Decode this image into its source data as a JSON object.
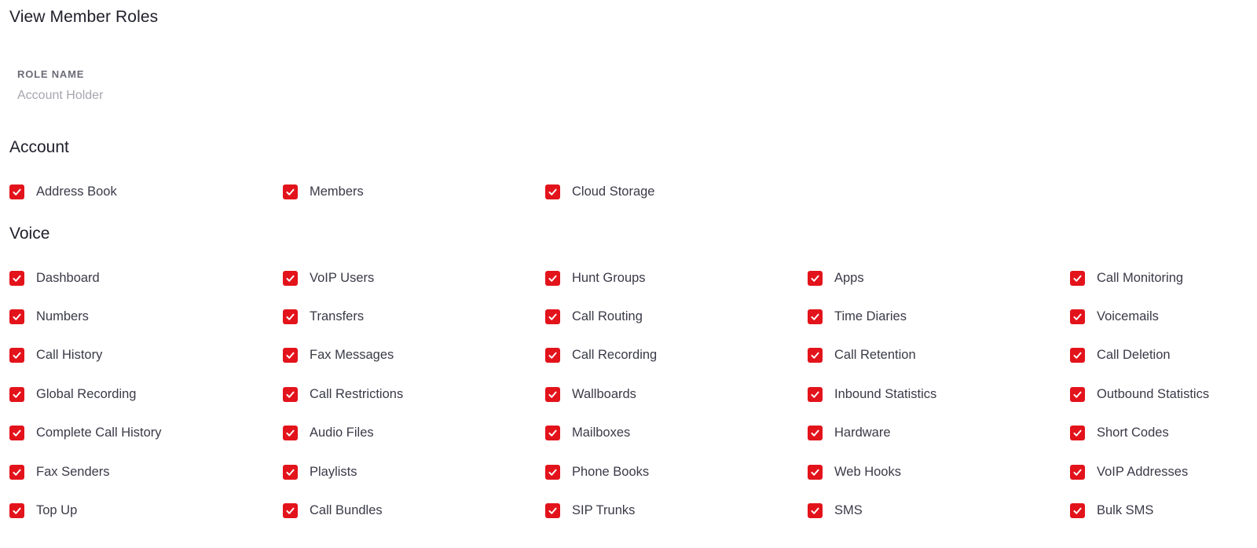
{
  "page": {
    "title": "View Member Roles"
  },
  "role": {
    "label": "ROLE NAME",
    "value": "Account Holder"
  },
  "colors": {
    "accent": "#e3131b",
    "title_text": "#1f1f2b",
    "label_text": "#6c6c78",
    "muted_text": "#a6a6ae"
  },
  "icons": {
    "checkbox": "checkmark-icon"
  },
  "sections": [
    {
      "title": "Account",
      "items": [
        {
          "label": "Address Book",
          "checked": true
        },
        {
          "label": "Members",
          "checked": true
        },
        {
          "label": "Cloud Storage",
          "checked": true
        }
      ]
    },
    {
      "title": "Voice",
      "items": [
        {
          "label": "Dashboard",
          "checked": true
        },
        {
          "label": "VoIP Users",
          "checked": true
        },
        {
          "label": "Hunt Groups",
          "checked": true
        },
        {
          "label": "Apps",
          "checked": true
        },
        {
          "label": "Call Monitoring",
          "checked": true
        },
        {
          "label": "Numbers",
          "checked": true
        },
        {
          "label": "Transfers",
          "checked": true
        },
        {
          "label": "Call Routing",
          "checked": true
        },
        {
          "label": "Time Diaries",
          "checked": true
        },
        {
          "label": "Voicemails",
          "checked": true
        },
        {
          "label": "Call History",
          "checked": true
        },
        {
          "label": "Fax Messages",
          "checked": true
        },
        {
          "label": "Call Recording",
          "checked": true
        },
        {
          "label": "Call Retention",
          "checked": true
        },
        {
          "label": "Call Deletion",
          "checked": true
        },
        {
          "label": "Global Recording",
          "checked": true
        },
        {
          "label": "Call Restrictions",
          "checked": true
        },
        {
          "label": "Wallboards",
          "checked": true
        },
        {
          "label": "Inbound Statistics",
          "checked": true
        },
        {
          "label": "Outbound Statistics",
          "checked": true
        },
        {
          "label": "Complete Call History",
          "checked": true
        },
        {
          "label": "Audio Files",
          "checked": true
        },
        {
          "label": "Mailboxes",
          "checked": true
        },
        {
          "label": "Hardware",
          "checked": true
        },
        {
          "label": "Short Codes",
          "checked": true
        },
        {
          "label": "Fax Senders",
          "checked": true
        },
        {
          "label": "Playlists",
          "checked": true
        },
        {
          "label": "Phone Books",
          "checked": true
        },
        {
          "label": "Web Hooks",
          "checked": true
        },
        {
          "label": "VoIP Addresses",
          "checked": true
        },
        {
          "label": "Top Up",
          "checked": true
        },
        {
          "label": "Call Bundles",
          "checked": true
        },
        {
          "label": "SIP Trunks",
          "checked": true
        },
        {
          "label": "SMS",
          "checked": true
        },
        {
          "label": "Bulk SMS",
          "checked": true
        }
      ]
    }
  ]
}
